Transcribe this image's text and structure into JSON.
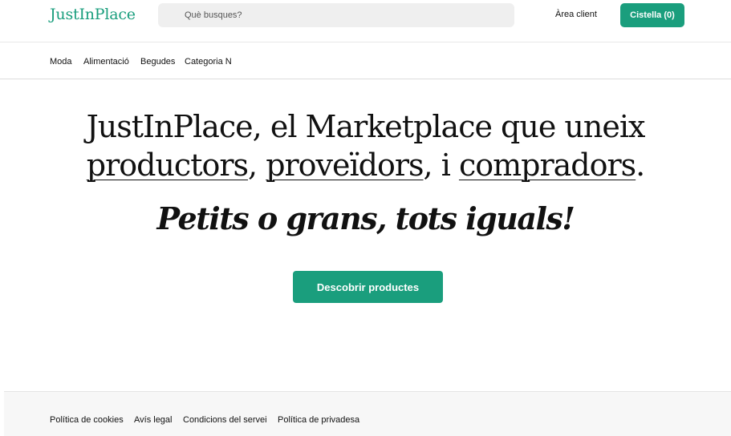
{
  "header": {
    "logo": "JustInPlace",
    "search_placeholder": "Què busques?",
    "account_link": "Àrea client",
    "cart_label": "Cistella (0)"
  },
  "nav": {
    "items": [
      {
        "label": "Moda"
      },
      {
        "label": "Alimentació"
      },
      {
        "label": "Begudes"
      },
      {
        "label": "Categoria N"
      }
    ]
  },
  "hero": {
    "title_prefix": "JustInPlace, el Marketplace que uneix",
    "highlight_1": "productors",
    "sep_1": ", ",
    "highlight_2": "proveïdors",
    "sep_2": ", i ",
    "highlight_3": "compradors",
    "title_end": ".",
    "tagline": "Petits o grans, tots iguals!",
    "cta_label": "Descobrir productes"
  },
  "footer": {
    "links": [
      {
        "label": "Política de cookies"
      },
      {
        "label": "Avís legal"
      },
      {
        "label": "Condicions del servei"
      },
      {
        "label": "Política de privadesa"
      }
    ]
  },
  "colors": {
    "brand": "#1a9e7d",
    "search_bg": "#efefef",
    "footer_bg": "#f7f7f7"
  }
}
